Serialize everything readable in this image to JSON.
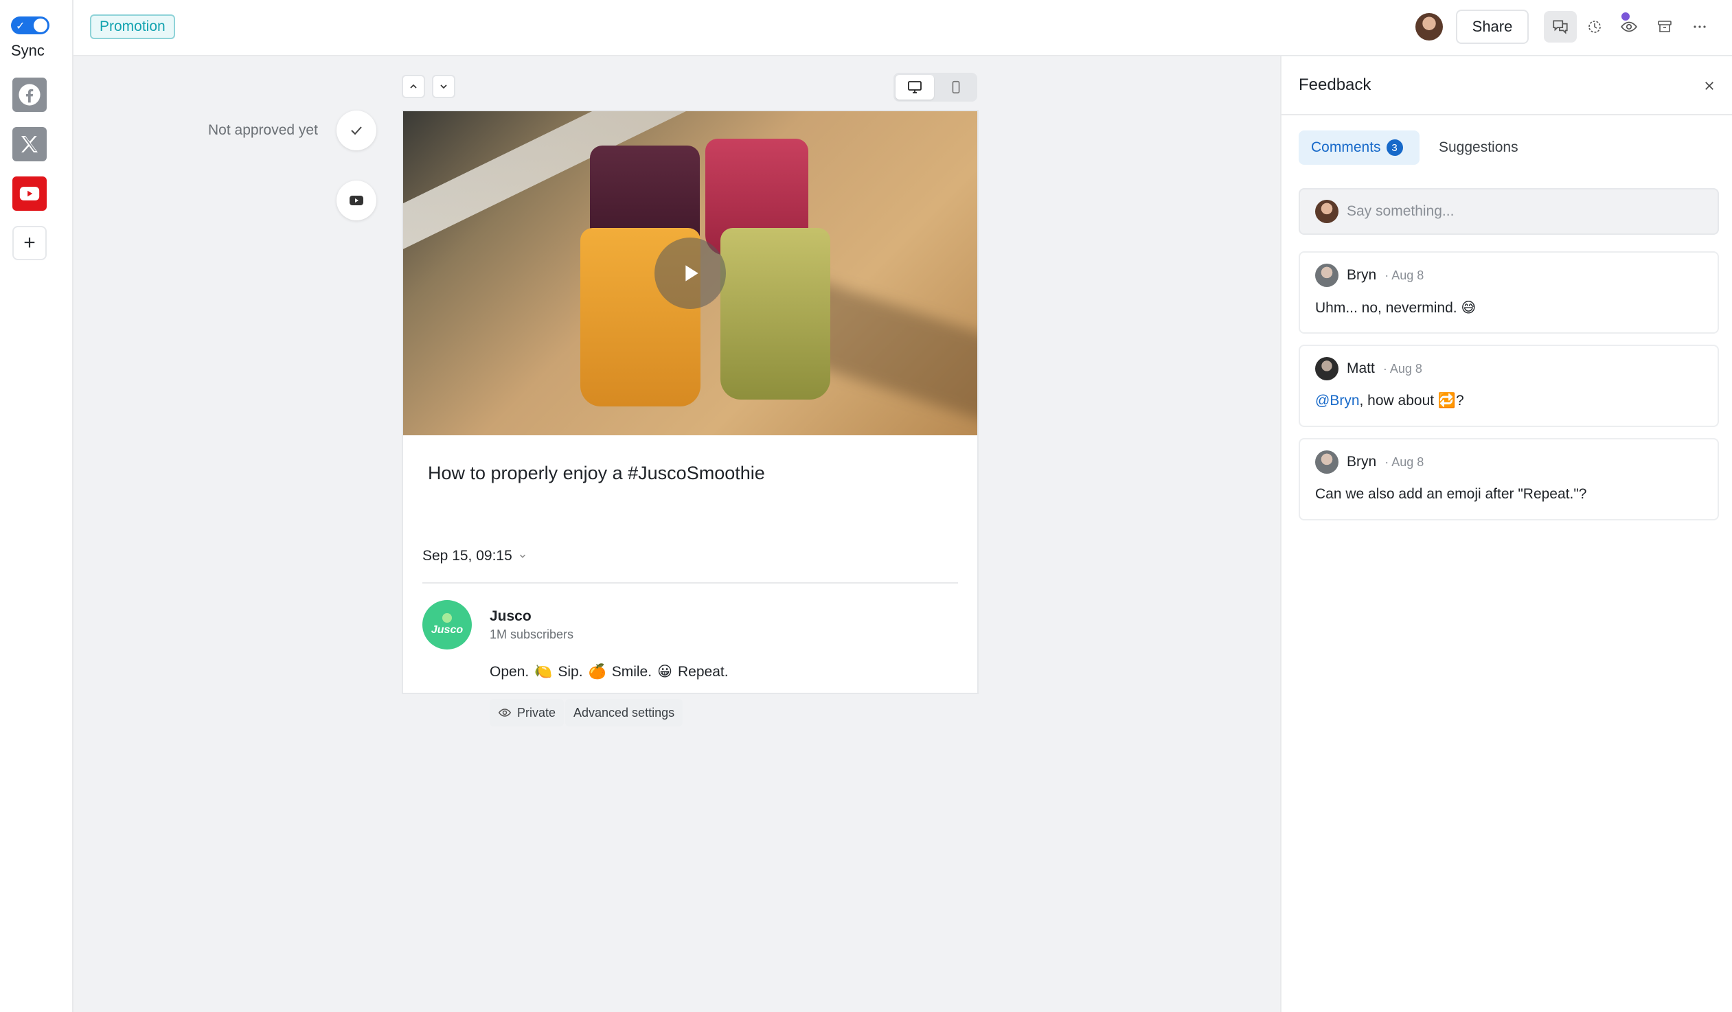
{
  "window": {
    "title": ""
  },
  "sidebar": {
    "sync_label": "Sync",
    "sync_enabled": true,
    "channels": [
      {
        "name": "facebook",
        "icon": "facebook-icon",
        "color": "#8a8f96"
      },
      {
        "name": "x",
        "icon": "x-icon",
        "color": "#8a8f96"
      },
      {
        "name": "youtube",
        "icon": "youtube-icon",
        "color": "#e1151b"
      }
    ],
    "add_icon": "plus-icon"
  },
  "topbar": {
    "tag": "Promotion",
    "share_label": "Share",
    "icons": [
      "feedback-icon",
      "history-icon",
      "preview-icon",
      "archive-icon",
      "more-icon"
    ]
  },
  "post": {
    "status": "Not approved yet",
    "title": "How to properly enjoy a #JuscoSmoothie",
    "date": "Sep 15, 09:15",
    "channel": {
      "name": "Jusco",
      "logo_text": "Jusco",
      "subscribers": "1M subscribers"
    },
    "description_parts": [
      "Open.",
      "🍋",
      "Sip.",
      "🍊",
      "Smile.",
      "😀",
      "Repeat."
    ],
    "chips": {
      "private": "Private",
      "advanced": "Advanced settings"
    }
  },
  "feedback": {
    "title": "Feedback",
    "tabs": {
      "comments": "Comments",
      "comments_count": "3",
      "suggestions": "Suggestions"
    },
    "composer_placeholder": "Say something...",
    "comments": [
      {
        "author": "Bryn",
        "meta": "· Aug 8",
        "body": "Uhm... no, nevermind. 😅"
      },
      {
        "author": "Matt",
        "meta": "· Aug 8",
        "mention": "@Bryn",
        "body_rest": ", how about 🔁?"
      },
      {
        "author": "Bryn",
        "meta": "· Aug 8",
        "body": "Can we also add an emoji after \"Repeat.\"?"
      }
    ]
  },
  "colors": {
    "accent": "#1a73e8",
    "promotion_tag": "#14a3b0",
    "youtube": "#e1151b",
    "jusco_green": "#3ecc8a",
    "mention": "#1769c9"
  }
}
